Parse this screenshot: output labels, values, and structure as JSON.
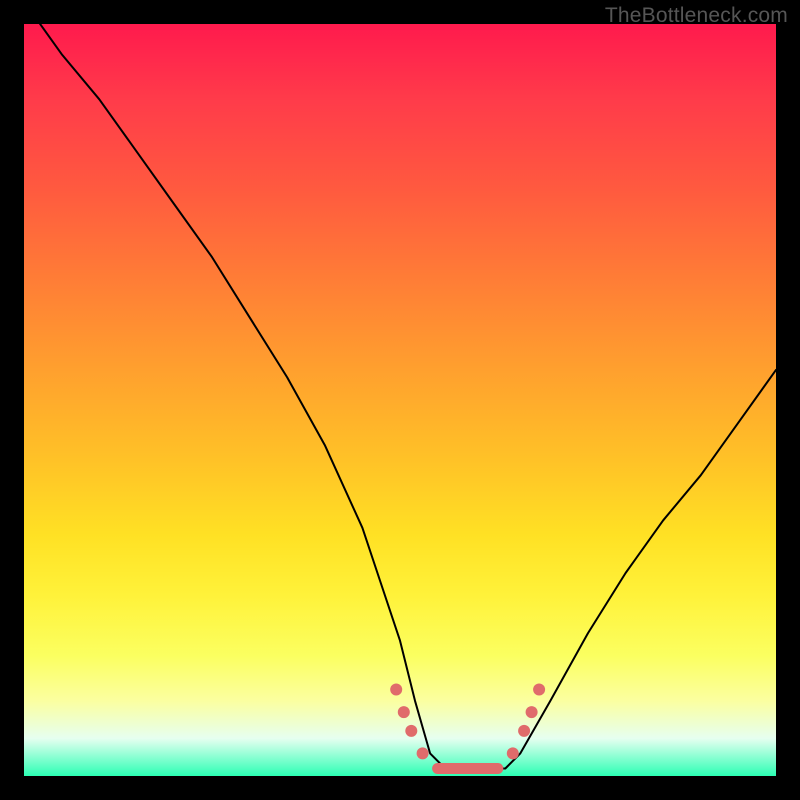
{
  "watermark": "TheBottleneck.com",
  "colors": {
    "frame": "#000000",
    "curve": "#000000",
    "marker": "#e06b6b",
    "gradient_top": "#ff1a4d",
    "gradient_bottom": "#2cffb4"
  },
  "chart_data": {
    "type": "line",
    "title": "",
    "xlabel": "",
    "ylabel": "",
    "xlim": [
      0,
      100
    ],
    "ylim": [
      0,
      100
    ],
    "grid": false,
    "legend": false,
    "x": [
      0,
      5,
      10,
      15,
      20,
      25,
      30,
      35,
      40,
      45,
      50,
      52,
      54,
      56,
      58,
      60,
      62,
      64,
      66,
      70,
      75,
      80,
      85,
      90,
      95,
      100
    ],
    "values_read_top_to_bottom": true,
    "values": [
      103,
      96,
      90,
      83,
      76,
      69,
      61,
      53,
      44,
      33,
      18,
      10,
      3,
      1,
      1,
      1,
      1,
      1,
      3,
      10,
      19,
      27,
      34,
      40,
      47,
      54
    ],
    "series": [
      {
        "name": "bottleneck-curve",
        "x": [
          0,
          5,
          10,
          15,
          20,
          25,
          30,
          35,
          40,
          45,
          50,
          52,
          54,
          56,
          58,
          60,
          62,
          64,
          66,
          70,
          75,
          80,
          85,
          90,
          95,
          100
        ],
        "y_percent_from_top": [
          103,
          96,
          90,
          83,
          76,
          69,
          61,
          53,
          44,
          33,
          18,
          10,
          3,
          1,
          1,
          1,
          1,
          1,
          3,
          10,
          19,
          27,
          34,
          40,
          47,
          54
        ]
      }
    ],
    "markers": [
      {
        "x": 49.5,
        "y_pct_top": 11.5
      },
      {
        "x": 50.5,
        "y_pct_top": 8.5
      },
      {
        "x": 51.5,
        "y_pct_top": 6.0
      },
      {
        "x": 53.0,
        "y_pct_top": 3.0
      },
      {
        "x_from": 55.0,
        "x_to": 63.0,
        "y_pct_top": 1.0,
        "segment": true
      },
      {
        "x": 65.0,
        "y_pct_top": 3.0
      },
      {
        "x": 66.5,
        "y_pct_top": 6.0
      },
      {
        "x": 67.5,
        "y_pct_top": 8.5
      },
      {
        "x": 68.5,
        "y_pct_top": 11.5
      }
    ]
  }
}
